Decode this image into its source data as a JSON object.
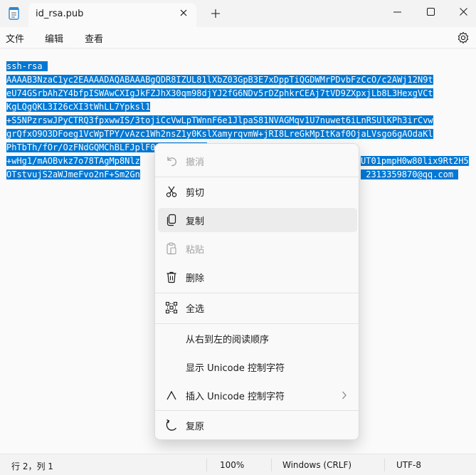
{
  "tab": {
    "title": "id_rsa.pub"
  },
  "menu": [
    "文件",
    "编辑",
    "查看"
  ],
  "editor": {
    "lines": [
      "ssh-rsa ",
      "AAAAB3NzaC1yc2EAAAADAQABAAABgQDR8IZUL81lXbZ03GpB3E7xDppTiQGDWMrPDvbFzCcO/c2AWj12N9t",
      "eU74GSrbAhZY4bfpISWAwCXIgJkFZJhX30qm98djYJ2fG6NDv5rDZphkrCEAj7tVD9ZXpxjLb8L3HexgVCt",
      "KgLQgQKL3I26cXI3tWhLL7Ypksl1",
      "+S5NPzrswJPyCTRQ3fpxwwIS/3tojiCcVwLpTWnnF6e1JlpaS81NVAGMqv1U7nuwet6iLnRSUlKPh3irCvw",
      "grQfxO9O3DFoeg1VcWpTPY/vAzc1Wh2nsZ1y0KslXamyrqvmW+jRI8LreGkMpItKaf0OjaLVsgo6gAOdaKl",
      "PhTbTh/fOr/OzFNdGQMChBLFJplF014b2AXd2j2",
      "+wHg1/mAOBvkz7o78TAgMp8Nlz",
      "OTstvujS2aWJmeFvo2nF+Sm2Gn"
    ],
    "line7_tail": "UT01pmpH0w80lix9Rt2H5",
    "line8_tail": " 2313359870@qq.com "
  },
  "context_menu": {
    "items": [
      {
        "label": "撤消",
        "icon": "undo-icon",
        "enabled": false
      },
      {
        "label": "剪切",
        "icon": "cut-icon",
        "enabled": true
      },
      {
        "label": "复制",
        "icon": "copy-icon",
        "enabled": true
      },
      {
        "label": "粘贴",
        "icon": "paste-icon",
        "enabled": false
      },
      {
        "label": "删除",
        "icon": "delete-icon",
        "enabled": true
      },
      {
        "label": "全选",
        "icon": "select-all-icon",
        "enabled": true
      },
      {
        "label": "从右到左的阅读顺序",
        "icon": "",
        "enabled": true
      },
      {
        "label": "显示 Unicode 控制字符",
        "icon": "",
        "enabled": true
      },
      {
        "label": "插入 Unicode 控制字符",
        "icon": "insert-caret-icon",
        "enabled": true
      },
      {
        "label": "复原",
        "icon": "reconvert-icon",
        "enabled": true
      }
    ]
  },
  "status": {
    "position": "行 2，列 1",
    "zoom": "100%",
    "line_ending": "Windows (CRLF)",
    "encoding": "UTF-8"
  },
  "colors": {
    "selection": "#0078d4",
    "background": "#fafafa",
    "chrome": "#f3f3f3"
  }
}
